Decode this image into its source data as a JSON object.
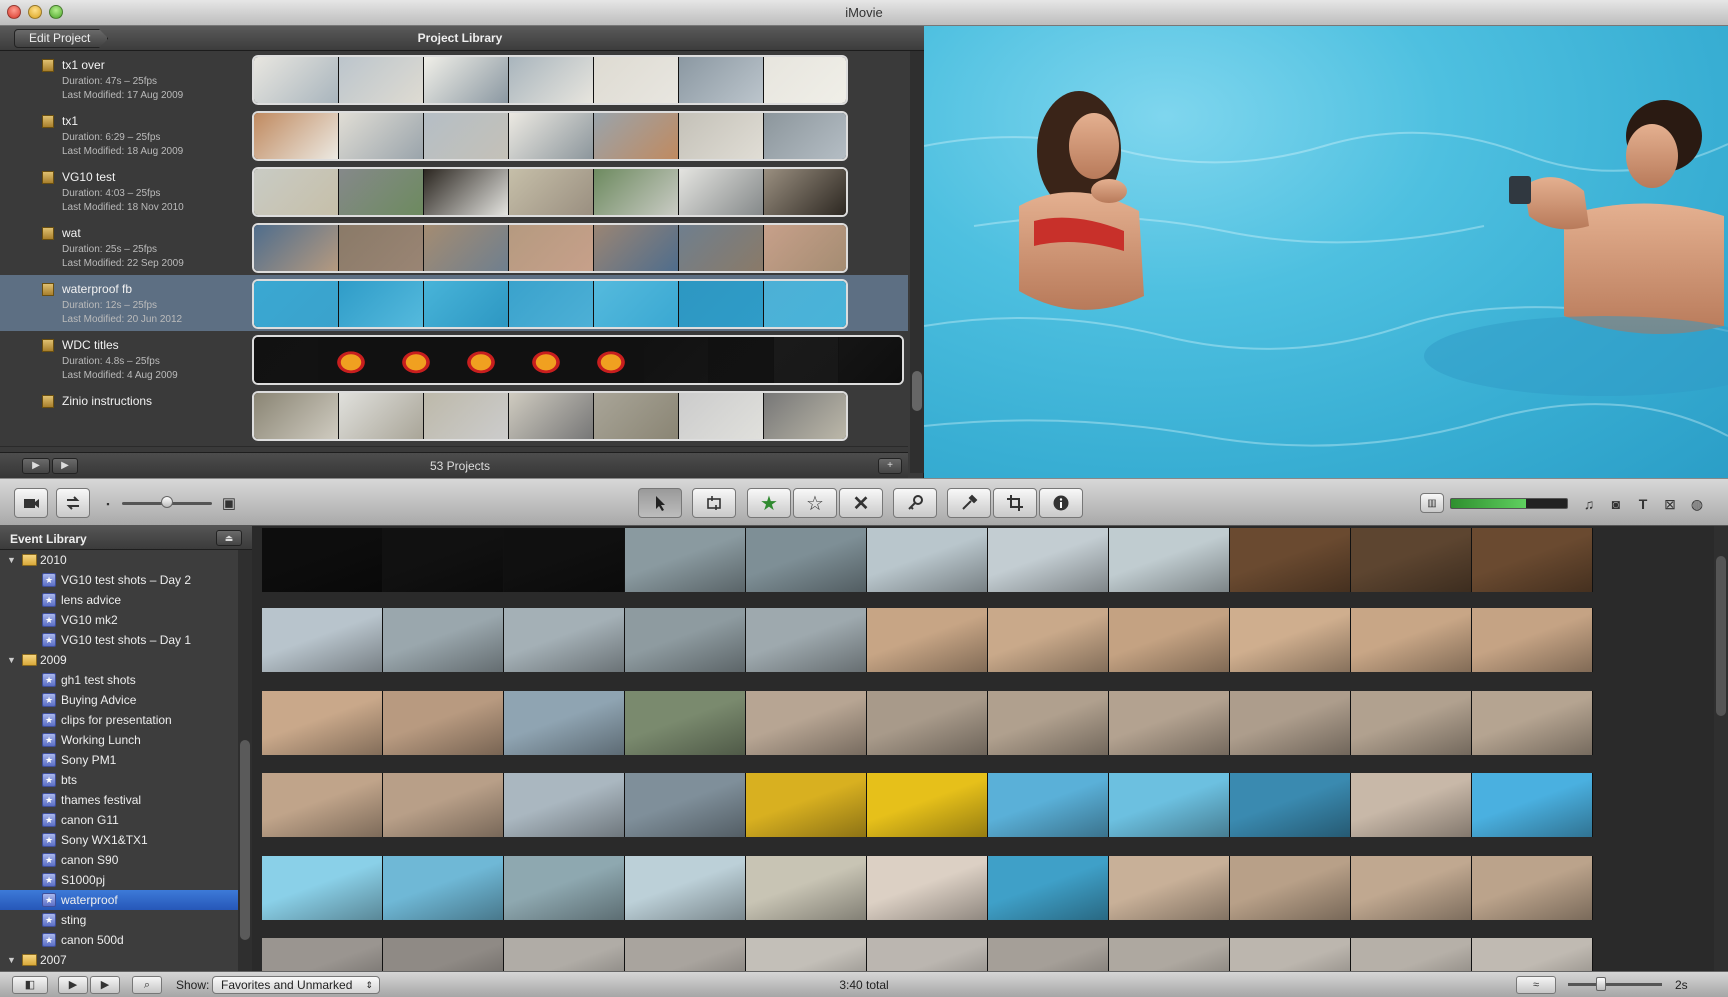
{
  "window": {
    "title": "iMovie"
  },
  "project_library": {
    "edit_button": "Edit Project",
    "title": "Project Library",
    "count": "53 Projects",
    "projects": [
      {
        "name": "tx1 over",
        "duration": "Duration: 47s – 25fps",
        "modified": "Last Modified: 17 Aug 2009"
      },
      {
        "name": "tx1",
        "duration": "Duration: 6:29 – 25fps",
        "modified": "Last Modified: 18 Aug 2009"
      },
      {
        "name": "VG10 test",
        "duration": "Duration: 4:03 – 25fps",
        "modified": "Last Modified: 18 Nov 2010"
      },
      {
        "name": "wat",
        "duration": "Duration: 25s – 25fps",
        "modified": "Last Modified: 22 Sep 2009"
      },
      {
        "name": "waterproof fb",
        "duration": "Duration: 12s – 25fps",
        "modified": "Last Modified: 20 Jun 2012"
      },
      {
        "name": "WDC titles",
        "duration": "Duration: 4.8s – 25fps",
        "modified": "Last Modified: 4 Aug 2009"
      },
      {
        "name": "Zinio instructions",
        "duration": "",
        "modified": ""
      }
    ]
  },
  "toolbar": {
    "icons": [
      "camera-icon",
      "swap-icon",
      "small-frame-icon",
      "large-frame-icon",
      "arrow-icon",
      "crop-clip-icon",
      "favorite-star-icon",
      "unmark-star-icon",
      "reject-x-icon",
      "keyword-icon",
      "eyedropper-icon",
      "crop-icon",
      "info-icon",
      "music-icon",
      "photo-icon",
      "title-icon",
      "transition-icon",
      "map-icon"
    ],
    "audio_level": 0.65,
    "colors": {
      "accent": "#2f6fd0",
      "level": "#3fb03f"
    }
  },
  "event_library": {
    "title": "Event Library",
    "years": [
      {
        "year": "2010",
        "events": [
          "VG10 test shots – Day 2",
          "lens advice",
          "VG10 mk2",
          "VG10 test shots – Day 1"
        ]
      },
      {
        "year": "2009",
        "events": [
          "gh1 test shots",
          "Buying Advice",
          "clips for presentation",
          "Working Lunch",
          "Sony PM1",
          "bts",
          "thames festival",
          "canon G11",
          "Sony WX1&TX1",
          "canon S90",
          "S1000pj",
          "waterproof",
          "sting",
          "canon 500d"
        ]
      },
      {
        "year": "2007",
        "events": []
      }
    ],
    "selected": "waterproof"
  },
  "bottom": {
    "show_label": "Show:",
    "show_value": "Favorites and Unmarked",
    "total": "3:40 total",
    "duration": "2s"
  }
}
